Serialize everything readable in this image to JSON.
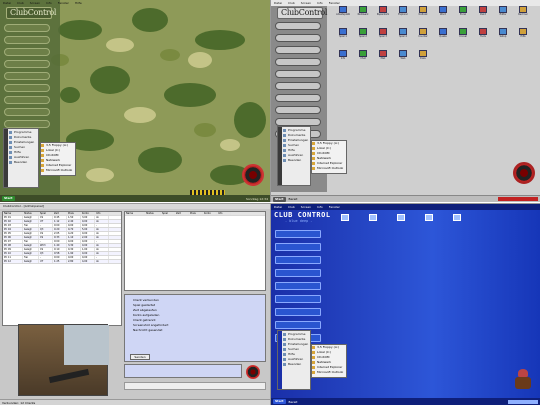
{
  "menu": [
    "Datei",
    "Club",
    "Screen",
    "Info",
    "Fenster",
    "Hilfe"
  ],
  "camo_panel": {
    "logo_text": "ClubControl",
    "start_label": "Start",
    "clock_text": "Sonntag 12:34",
    "start_menu": [
      "Programme",
      "Dokumente",
      "Einstellungen",
      "Suchen",
      "Hilfe",
      "Ausführen",
      "Beenden"
    ],
    "sub_menu": [
      "3,5 Floppy (A:)",
      "Lokal (C:)",
      "CD-ROM",
      "Netzwerk",
      "Internet Explorer",
      "Microsoft Outlook"
    ]
  },
  "gray_panel": {
    "logo_text": "ClubControl",
    "start_label": "Start",
    "task_label": "Bereit",
    "start_menu": [
      "Programme",
      "Dokumente",
      "Einstellungen",
      "Suchen",
      "Hilfe",
      "Ausführen",
      "Beenden"
    ],
    "sub_menu": [
      "3,5 Floppy (A:)",
      "Lokal (C:)",
      "CD-ROM",
      "Netzwerk",
      "Internet Explorer",
      "Microsoft Outlook"
    ],
    "icons": [
      "Arbeitsplatz",
      "Netzwerk",
      "Papierkorb",
      "Explorer",
      "Outlook",
      "Word",
      "Excel",
      "Paint",
      "Editor",
      "Rechner",
      "Spiel 1",
      "Spiel 2",
      "Spiel 3",
      "Spiel 4",
      "Counter",
      "Quake",
      "Unreal",
      "Tools",
      "Setup",
      "Hilfe",
      "Info",
      "Chat",
      "Mail",
      "Web",
      "Doku"
    ]
  },
  "admin_panel": {
    "title": "ClubControl - [Adminpanel]",
    "columns": [
      "Name",
      "Status",
      "Spiel",
      "Zeit",
      "Preis",
      "Konto",
      "Info"
    ],
    "rows": [
      [
        "PC 01",
        "belegt",
        "CS",
        "0:45",
        "1,50",
        "3,00",
        "ok"
      ],
      [
        "PC 02",
        "belegt",
        "UT",
        "1:12",
        "2,40",
        "0,00",
        "ok"
      ],
      [
        "PC 03",
        "frei",
        "-",
        "0:00",
        "0,00",
        "0,00",
        "-"
      ],
      [
        "PC 04",
        "belegt",
        "Q3",
        "0:20",
        "0,70",
        "5,00",
        "ok"
      ],
      [
        "PC 05",
        "belegt",
        "CS",
        "2:05",
        "4,20",
        "0,00",
        "ok"
      ],
      [
        "PC 06",
        "belegt",
        "CS",
        "0:33",
        "1,10",
        "2,00",
        "ok"
      ],
      [
        "PC 07",
        "frei",
        "-",
        "0:00",
        "0,00",
        "0,00",
        "-"
      ],
      [
        "PC 08",
        "belegt",
        "WC3",
        "1:40",
        "3,30",
        "0,00",
        "ok"
      ],
      [
        "PC 09",
        "belegt",
        "CS",
        "0:10",
        "0,30",
        "1,00",
        "ok"
      ],
      [
        "PC 10",
        "belegt",
        "Q3",
        "0:58",
        "1,90",
        "0,00",
        "ok"
      ],
      [
        "PC 11",
        "frei",
        "-",
        "0:00",
        "0,00",
        "0,00",
        "-"
      ],
      [
        "PC 12",
        "belegt",
        "UT",
        "1:25",
        "2,80",
        "4,00",
        "ok"
      ]
    ],
    "log_lines": [
      "Client verbunden",
      "Spiel gestartet",
      "Zeit abgelaufen",
      "Konto aufgeladen",
      "Client getrennt",
      "Screenshot angefordert",
      "Nachricht gesendet"
    ],
    "button_label": "Senden",
    "status_text": "Verbunden: 12 Clients"
  },
  "blue_panel": {
    "logo_text": "CLUB CONTROL",
    "tagline": "- blue deep -",
    "start_label": "Start",
    "task_label": "Bereit",
    "start_menu": [
      "Programme",
      "Dokumente",
      "Einstellungen",
      "Suchen",
      "Hilfe",
      "Ausführen",
      "Beenden"
    ],
    "sub_menu": [
      "3,5 Floppy (A:)",
      "Lokal (C:)",
      "CD-ROM",
      "Netzwerk",
      "Internet Explorer",
      "Microsoft Outlook"
    ]
  },
  "colors": {
    "camo_dark": "#4d6b2c",
    "camo_light": "#b5b77a",
    "gray_bg": "#cfcfcf",
    "blue_bg": "#1f3fc4",
    "admin_blue": "#cfd6f5",
    "accent_red": "#c22222"
  }
}
